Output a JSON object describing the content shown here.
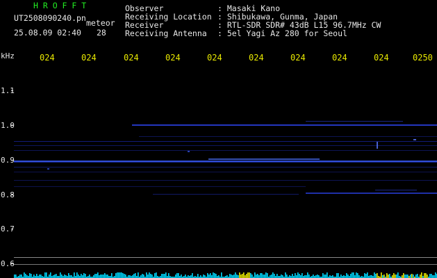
{
  "header": {
    "program": "H R O F F T",
    "filename": "UT2508090240.pn",
    "mode": "meteor",
    "datetime": "25.08.09 02:40",
    "count": "28",
    "fields": [
      {
        "label": "Observer",
        "value": ": Masaki Kano"
      },
      {
        "label": "Receiving Location",
        "value": ": Shibukawa, Gunma, Japan"
      },
      {
        "label": "Receiver",
        "value": ": RTL-SDR SDR# 43dB L15 96.7MHz CW"
      },
      {
        "label": "Receiving Antenna",
        "value": ": 5el Yagi Az 280 for Seoul"
      }
    ]
  },
  "time_ticks": [
    "024",
    "024",
    "024",
    "024",
    "024",
    "024",
    "024",
    "024",
    "024",
    "0250"
  ],
  "yaxis": {
    "unit": "kHz",
    "labels": [
      "1.1",
      "1.0",
      "0.9",
      "0.8",
      "0.7",
      "0.6"
    ]
  },
  "colors": {
    "background": "#000000",
    "label_yellow": "#e8e800",
    "title_green": "#22ee22",
    "trace_blue": "#3a5cff",
    "noise_cyan": "#00d8ff"
  }
}
